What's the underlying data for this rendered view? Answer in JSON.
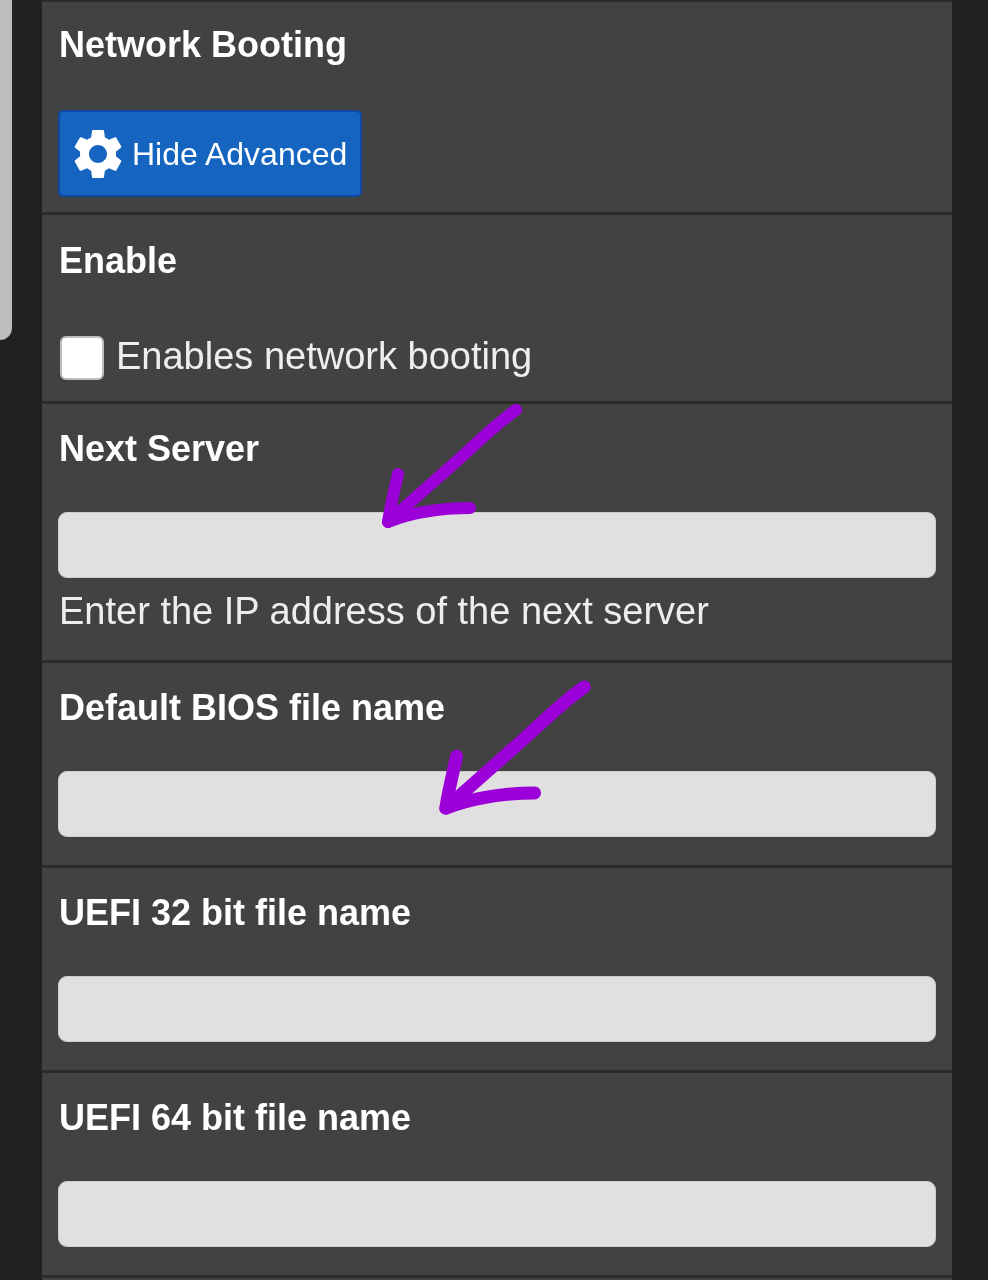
{
  "sections": [
    {
      "kind": "header",
      "title": "Network Booting",
      "button": "Hide Advanced",
      "marked": false
    },
    {
      "kind": "checkbox",
      "title": "Enable",
      "checked": false,
      "label": "Enables network booting",
      "marked": false
    },
    {
      "kind": "text",
      "title": "Next Server",
      "help": "Enter the IP address of the next server",
      "marked": true
    },
    {
      "kind": "text",
      "title": "Default BIOS file name",
      "marked": true
    },
    {
      "kind": "text",
      "title": "UEFI 32 bit file name",
      "marked": false
    },
    {
      "kind": "text",
      "title": "UEFI 64 bit file name",
      "marked": false
    }
  ]
}
